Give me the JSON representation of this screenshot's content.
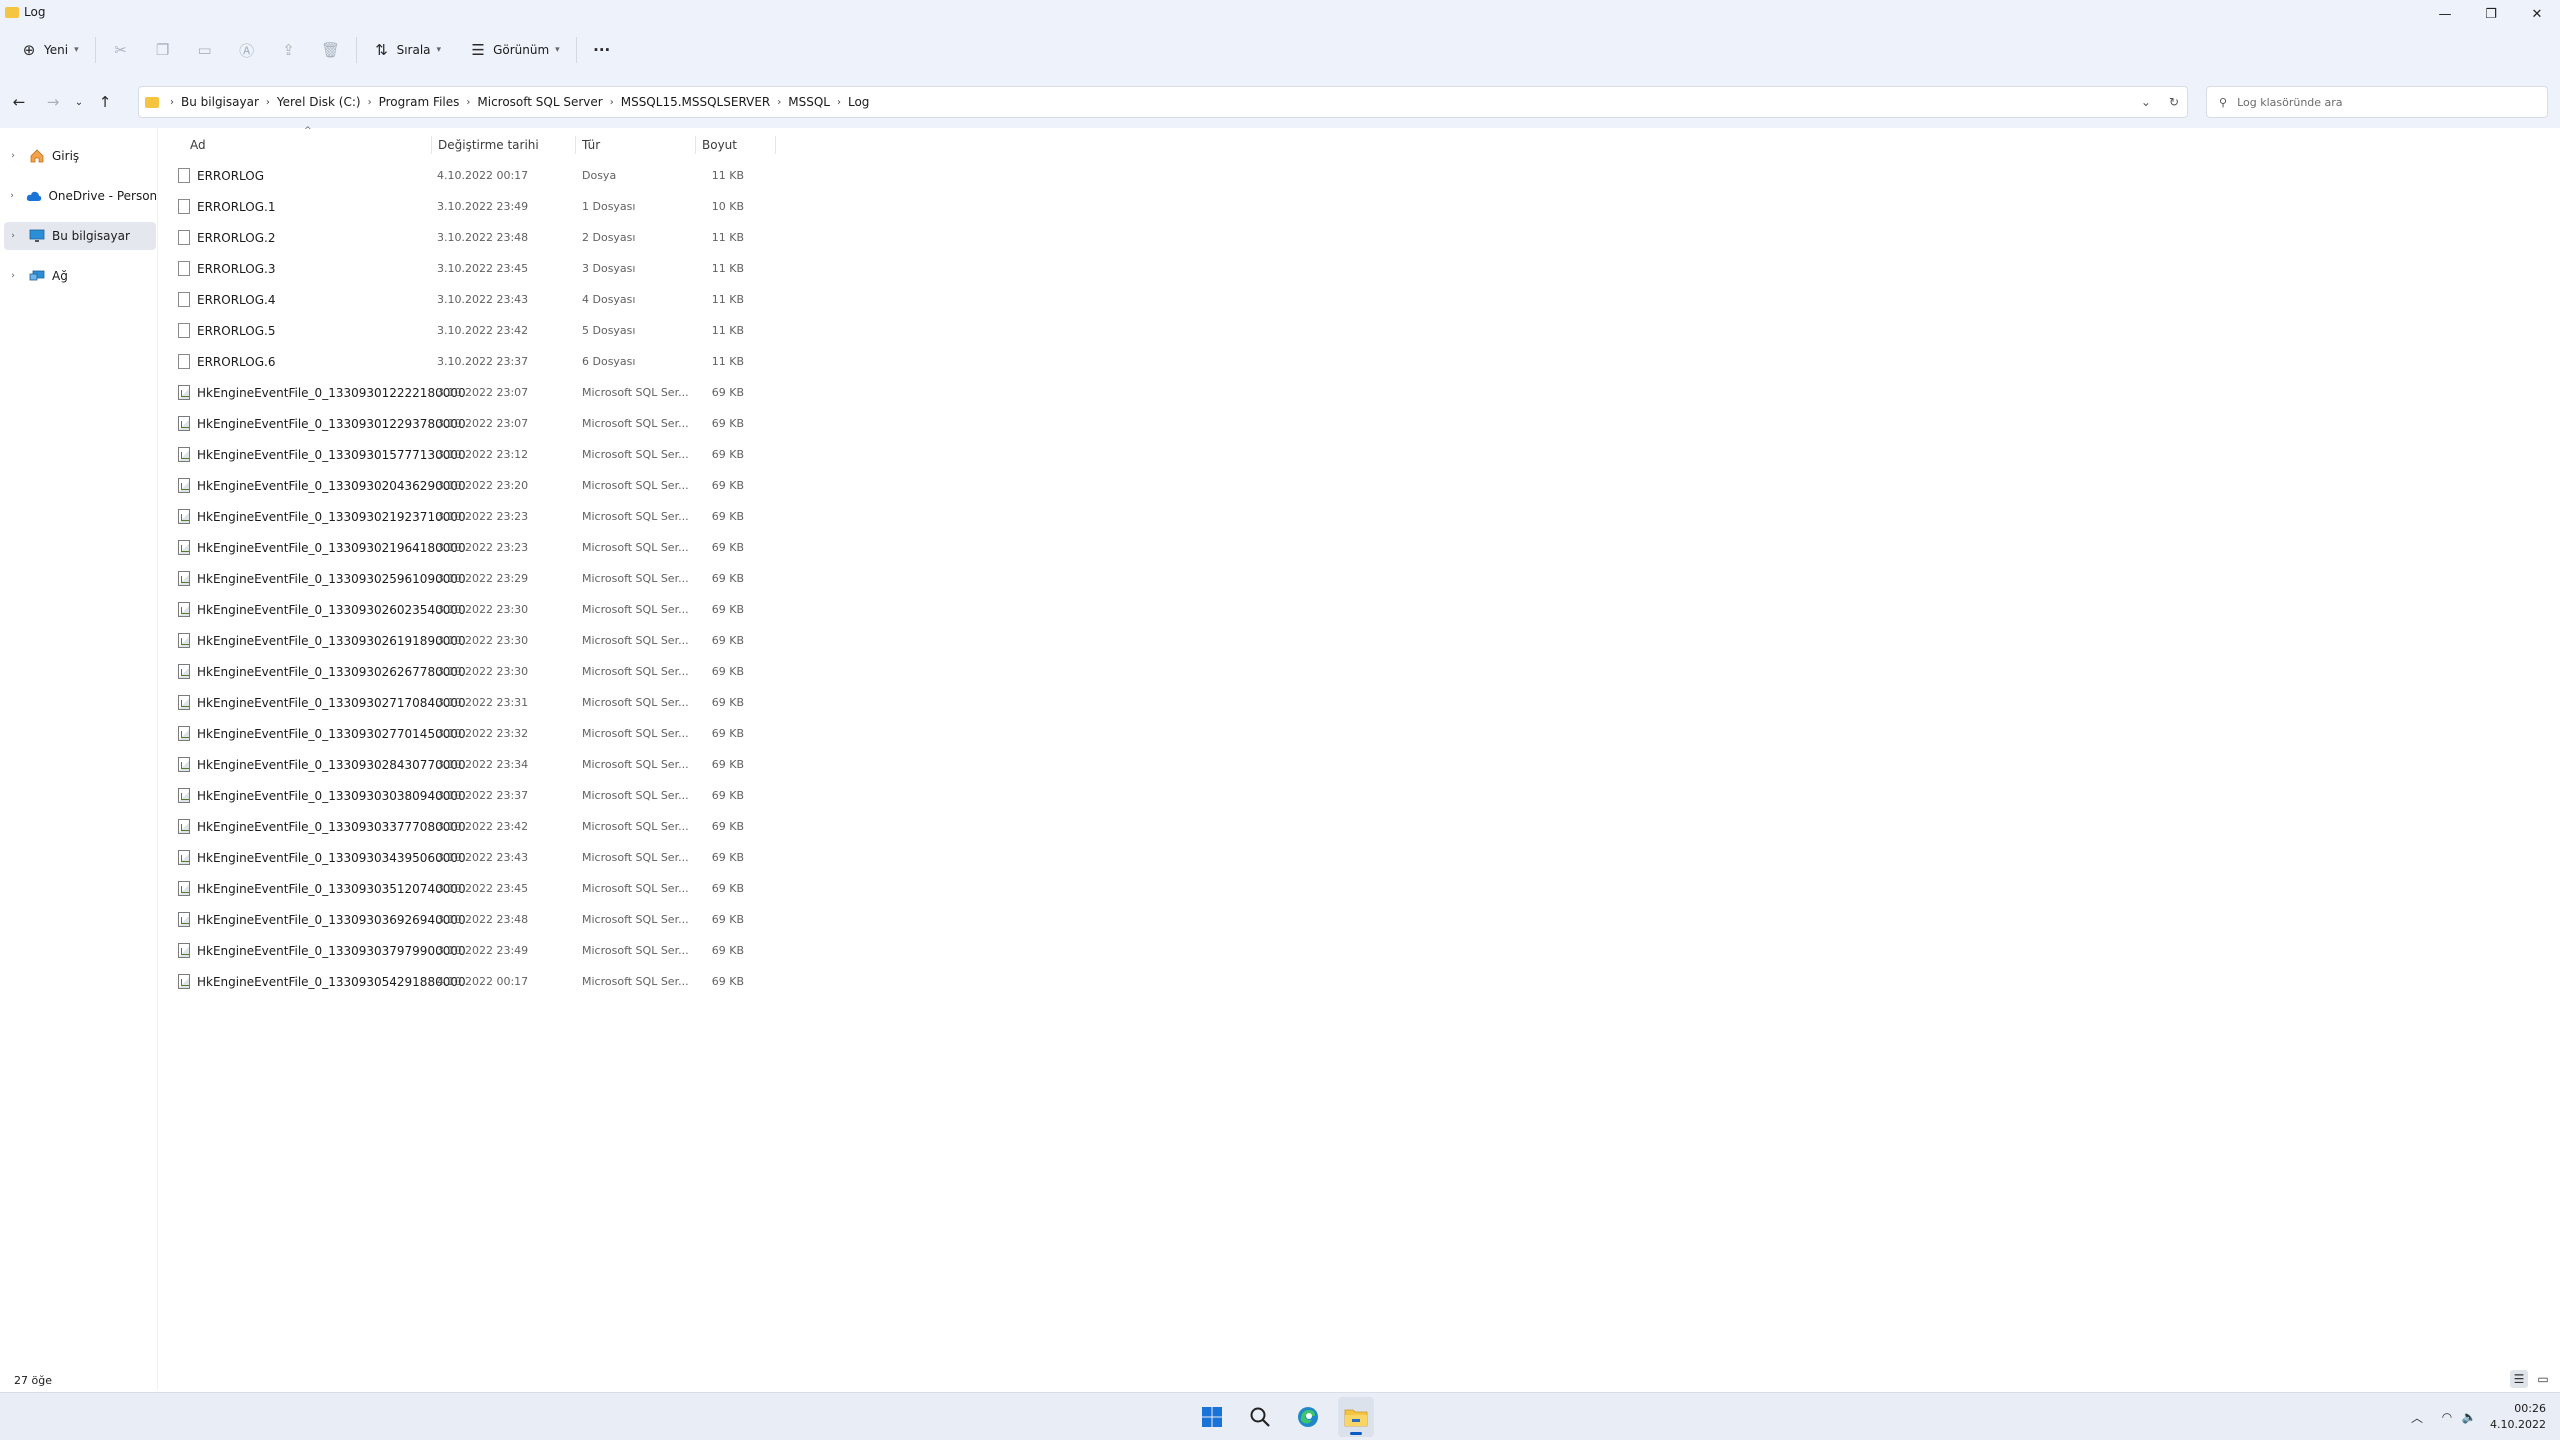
{
  "window": {
    "title": "Log",
    "controls": {
      "minimize": "—",
      "maximize": "❐",
      "close": "✕"
    }
  },
  "toolbar": {
    "new_label": "Yeni",
    "sort_label": "Sırala",
    "view_label": "Görünüm",
    "more_label": "···"
  },
  "address": {
    "crumbs": [
      "Bu bilgisayar",
      "Yerel Disk (C:)",
      "Program Files",
      "Microsoft SQL Server",
      "MSSQL15.MSSQLSERVER",
      "MSSQL",
      "Log"
    ]
  },
  "search": {
    "placeholder": "Log klasöründe ara"
  },
  "nav": {
    "items": [
      {
        "label": "Giriş",
        "icon": "home-icon"
      },
      {
        "label": "OneDrive - Personal",
        "icon": "cloud-icon"
      },
      {
        "label": "Bu bilgisayar",
        "icon": "pc-icon"
      },
      {
        "label": "Ağ",
        "icon": "network-icon"
      }
    ]
  },
  "columns": {
    "name": "Ad",
    "date": "Değiştirme tarihi",
    "type": "Tür",
    "size": "Boyut"
  },
  "files": [
    {
      "name": "ERRORLOG",
      "date": "4.10.2022 00:17",
      "type": "Dosya",
      "size": "11 KB",
      "icon": "file-icon"
    },
    {
      "name": "ERRORLOG.1",
      "date": "3.10.2022 23:49",
      "type": "1 Dosyası",
      "size": "10 KB",
      "icon": "file-icon"
    },
    {
      "name": "ERRORLOG.2",
      "date": "3.10.2022 23:48",
      "type": "2 Dosyası",
      "size": "11 KB",
      "icon": "file-icon"
    },
    {
      "name": "ERRORLOG.3",
      "date": "3.10.2022 23:45",
      "type": "3 Dosyası",
      "size": "11 KB",
      "icon": "file-icon"
    },
    {
      "name": "ERRORLOG.4",
      "date": "3.10.2022 23:43",
      "type": "4 Dosyası",
      "size": "11 KB",
      "icon": "file-icon"
    },
    {
      "name": "ERRORLOG.5",
      "date": "3.10.2022 23:42",
      "type": "5 Dosyası",
      "size": "11 KB",
      "icon": "file-icon"
    },
    {
      "name": "ERRORLOG.6",
      "date": "3.10.2022 23:37",
      "type": "6 Dosyası",
      "size": "11 KB",
      "icon": "file-icon"
    },
    {
      "name": "HkEngineEventFile_0_133093012222180000",
      "date": "3.10.2022 23:07",
      "type": "Microsoft SQL Ser...",
      "size": "69 KB",
      "icon": "sql-file-icon"
    },
    {
      "name": "HkEngineEventFile_0_133093012293780000",
      "date": "3.10.2022 23:07",
      "type": "Microsoft SQL Ser...",
      "size": "69 KB",
      "icon": "sql-file-icon"
    },
    {
      "name": "HkEngineEventFile_0_133093015777130000",
      "date": "3.10.2022 23:12",
      "type": "Microsoft SQL Ser...",
      "size": "69 KB",
      "icon": "sql-file-icon"
    },
    {
      "name": "HkEngineEventFile_0_133093020436290000",
      "date": "3.10.2022 23:20",
      "type": "Microsoft SQL Ser...",
      "size": "69 KB",
      "icon": "sql-file-icon"
    },
    {
      "name": "HkEngineEventFile_0_133093021923710000",
      "date": "3.10.2022 23:23",
      "type": "Microsoft SQL Ser...",
      "size": "69 KB",
      "icon": "sql-file-icon"
    },
    {
      "name": "HkEngineEventFile_0_133093021964180000",
      "date": "3.10.2022 23:23",
      "type": "Microsoft SQL Ser...",
      "size": "69 KB",
      "icon": "sql-file-icon"
    },
    {
      "name": "HkEngineEventFile_0_133093025961090000",
      "date": "3.10.2022 23:29",
      "type": "Microsoft SQL Ser...",
      "size": "69 KB",
      "icon": "sql-file-icon"
    },
    {
      "name": "HkEngineEventFile_0_133093026023540000",
      "date": "3.10.2022 23:30",
      "type": "Microsoft SQL Ser...",
      "size": "69 KB",
      "icon": "sql-file-icon"
    },
    {
      "name": "HkEngineEventFile_0_133093026191890000",
      "date": "3.10.2022 23:30",
      "type": "Microsoft SQL Ser...",
      "size": "69 KB",
      "icon": "sql-file-icon"
    },
    {
      "name": "HkEngineEventFile_0_133093026267780000",
      "date": "3.10.2022 23:30",
      "type": "Microsoft SQL Ser...",
      "size": "69 KB",
      "icon": "sql-file-icon"
    },
    {
      "name": "HkEngineEventFile_0_133093027170840000",
      "date": "3.10.2022 23:31",
      "type": "Microsoft SQL Ser...",
      "size": "69 KB",
      "icon": "sql-file-icon"
    },
    {
      "name": "HkEngineEventFile_0_133093027701450000",
      "date": "3.10.2022 23:32",
      "type": "Microsoft SQL Ser...",
      "size": "69 KB",
      "icon": "sql-file-icon"
    },
    {
      "name": "HkEngineEventFile_0_133093028430770000",
      "date": "3.10.2022 23:34",
      "type": "Microsoft SQL Ser...",
      "size": "69 KB",
      "icon": "sql-file-icon"
    },
    {
      "name": "HkEngineEventFile_0_133093030380940000",
      "date": "3.10.2022 23:37",
      "type": "Microsoft SQL Ser...",
      "size": "69 KB",
      "icon": "sql-file-icon"
    },
    {
      "name": "HkEngineEventFile_0_133093033777080000",
      "date": "3.10.2022 23:42",
      "type": "Microsoft SQL Ser...",
      "size": "69 KB",
      "icon": "sql-file-icon"
    },
    {
      "name": "HkEngineEventFile_0_133093034395060000",
      "date": "3.10.2022 23:43",
      "type": "Microsoft SQL Ser...",
      "size": "69 KB",
      "icon": "sql-file-icon"
    },
    {
      "name": "HkEngineEventFile_0_133093035120740000",
      "date": "3.10.2022 23:45",
      "type": "Microsoft SQL Ser...",
      "size": "69 KB",
      "icon": "sql-file-icon"
    },
    {
      "name": "HkEngineEventFile_0_133093036926940000",
      "date": "3.10.2022 23:48",
      "type": "Microsoft SQL Ser...",
      "size": "69 KB",
      "icon": "sql-file-icon"
    },
    {
      "name": "HkEngineEventFile_0_133093037979900000",
      "date": "3.10.2022 23:49",
      "type": "Microsoft SQL Ser...",
      "size": "69 KB",
      "icon": "sql-file-icon"
    },
    {
      "name": "HkEngineEventFile_0_133093054291880000",
      "date": "4.10.2022 00:17",
      "type": "Microsoft SQL Ser...",
      "size": "69 KB",
      "icon": "sql-file-icon"
    }
  ],
  "status": {
    "item_count": "27 öğe"
  },
  "taskbar": {
    "time": "00:26",
    "date": "4.10.2022"
  },
  "colors": {
    "chrome_bg": "#eef3fb",
    "accent": "#0a5cc2",
    "folder": "#f5c542"
  }
}
